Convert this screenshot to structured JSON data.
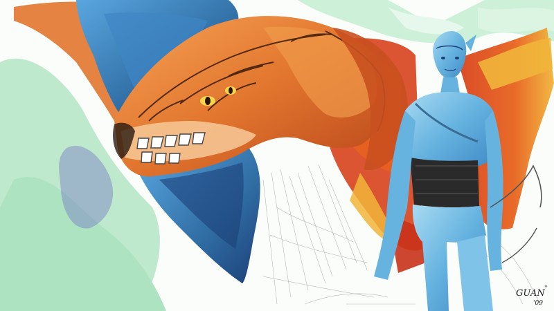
{
  "artwork": {
    "subject_left": "orange-blue-flying-creature",
    "subject_right": "blue-humanoid-figure",
    "signature_line1": "GUAN",
    "signature_mark": "''",
    "signature_line2": "'09",
    "colors": {
      "background": "#fbfdfb",
      "green_wash": "#7fd49a",
      "creature_orange": "#e2762e",
      "creature_dark_orange": "#b8451b",
      "creature_blue": "#2f6da3",
      "creature_dark_blue": "#1d3f78",
      "figure_blue": "#66b3e0",
      "figure_light_blue": "#a8daf2",
      "wing_red": "#d8421d",
      "wing_yellow": "#f1b53a",
      "belt_black": "#2a2a2a",
      "sketch_gray": "#9a9a9a"
    }
  }
}
